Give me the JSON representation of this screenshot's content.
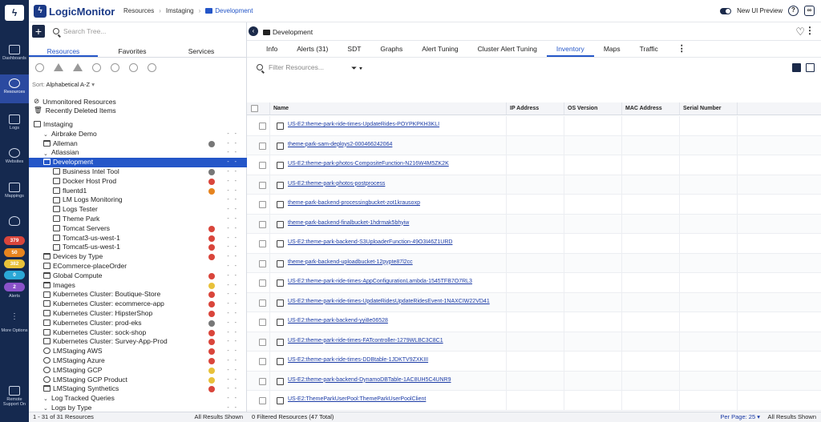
{
  "nav": {
    "items": [
      {
        "label": "Dashboards",
        "icon": "dashboards-icon"
      },
      {
        "label": "Resources",
        "icon": "resources-icon"
      },
      {
        "label": "Logs",
        "icon": "logs-icon"
      },
      {
        "label": "Websites",
        "icon": "websites-icon"
      },
      {
        "label": "Mappings",
        "icon": "mappings-icon"
      }
    ],
    "alert_counts": [
      {
        "value": "379",
        "color": "#d9453b"
      },
      {
        "value": "50",
        "color": "#e6841f"
      },
      {
        "value": "382",
        "color": "#e8c13a"
      },
      {
        "value": "0",
        "color": "#2aa7d6"
      },
      {
        "value": "2",
        "color": "#8a52c9"
      }
    ],
    "alerts_label": "Alerts",
    "more_options_label": "More Options",
    "remote_support_label": "Remote Support On"
  },
  "topbar": {
    "brand": "LogicMonitor",
    "breadcrumbs": [
      "Resources",
      "Imstaging",
      "Development"
    ],
    "new_ui_label": "New UI Preview",
    "help_icon": "help-icon",
    "link_icon": "link-icon"
  },
  "tree": {
    "search_placeholder": "Search Tree...",
    "tabs": [
      "Resources",
      "Favorites",
      "Services"
    ],
    "sort_prefix": "Sort:",
    "sort_value": "Alphabetical A-Z",
    "unmonitored": "Unmonitored Resources",
    "recently_deleted": "Recently Deleted Items",
    "items": [
      {
        "label": "Imstaging",
        "indent": 0,
        "icon": "group",
        "status": ""
      },
      {
        "label": "Airbrake Demo",
        "indent": 1,
        "icon": "caret",
        "status": ""
      },
      {
        "label": "Alleman",
        "indent": 1,
        "icon": "folder",
        "status": "gray"
      },
      {
        "label": "Atlassian",
        "indent": 1,
        "icon": "caret",
        "status": ""
      },
      {
        "label": "Development",
        "indent": 1,
        "icon": "folder",
        "status": "",
        "selected": true
      },
      {
        "label": "Business Intel Tool",
        "indent": 2,
        "icon": "device",
        "status": "gray"
      },
      {
        "label": "Docker Host Prod",
        "indent": 2,
        "icon": "device",
        "status": "red"
      },
      {
        "label": "fluentd1",
        "indent": 2,
        "icon": "device",
        "status": "orange"
      },
      {
        "label": "LM Logs Monitoring",
        "indent": 2,
        "icon": "device",
        "status": ""
      },
      {
        "label": "Logs Tester",
        "indent": 2,
        "icon": "device",
        "status": ""
      },
      {
        "label": "Theme Park",
        "indent": 2,
        "icon": "device",
        "status": ""
      },
      {
        "label": "Tomcat Servers",
        "indent": 2,
        "icon": "device",
        "status": "red"
      },
      {
        "label": "Tomcat3-us-west-1",
        "indent": 2,
        "icon": "device",
        "status": "red"
      },
      {
        "label": "Tomcat5-us-west-1",
        "indent": 2,
        "icon": "device",
        "status": "red"
      },
      {
        "label": "Devices by Type",
        "indent": 1,
        "icon": "folder",
        "status": "red"
      },
      {
        "label": "ECommerce-placeOrder",
        "indent": 1,
        "icon": "device",
        "status": ""
      },
      {
        "label": "Global Compute",
        "indent": 1,
        "icon": "folder",
        "status": "red"
      },
      {
        "label": "Images",
        "indent": 1,
        "icon": "folder",
        "status": "yellow"
      },
      {
        "label": "Kubernetes Cluster: Boutique-Store",
        "indent": 1,
        "icon": "k8s",
        "status": "red"
      },
      {
        "label": "Kubernetes Cluster: ecommerce-app",
        "indent": 1,
        "icon": "k8s",
        "status": "red"
      },
      {
        "label": "Kubernetes Cluster: HipsterShop",
        "indent": 1,
        "icon": "k8s",
        "status": "red"
      },
      {
        "label": "Kubernetes Cluster: prod-eks",
        "indent": 1,
        "icon": "k8s",
        "status": "gray"
      },
      {
        "label": "Kubernetes Cluster: sock-shop",
        "indent": 1,
        "icon": "k8s",
        "status": "red"
      },
      {
        "label": "Kubernetes Cluster: Survey-App-Prod",
        "indent": 1,
        "icon": "k8s",
        "status": "red"
      },
      {
        "label": "LMStaging AWS",
        "indent": 1,
        "icon": "cloud",
        "status": "red"
      },
      {
        "label": "LMStaging Azure",
        "indent": 1,
        "icon": "cloud",
        "status": "red"
      },
      {
        "label": "LMStaging GCP",
        "indent": 1,
        "icon": "cloud",
        "status": "yellow"
      },
      {
        "label": "LMStaging GCP Product",
        "indent": 1,
        "icon": "cloud",
        "status": "yellow"
      },
      {
        "label": "LMStaging Synthetics",
        "indent": 1,
        "icon": "folder",
        "status": "red"
      },
      {
        "label": "Log Tracked Queries",
        "indent": 1,
        "icon": "caret",
        "status": ""
      },
      {
        "label": "Logs by Type",
        "indent": 1,
        "icon": "caret",
        "status": ""
      }
    ],
    "footer_left": "1 - 31 of 31 Resources",
    "footer_right": "All Results Shown"
  },
  "main": {
    "title": "Development",
    "tabs": [
      "Info",
      "Alerts (31)",
      "SDT",
      "Graphs",
      "Alert Tuning",
      "Cluster Alert Tuning",
      "Inventory",
      "Maps",
      "Traffic"
    ],
    "active_tab": "Inventory",
    "filter_placeholder": "Filter Resources...",
    "columns": [
      "Name",
      "IP Address",
      "OS Version",
      "MAC Address",
      "Serial Number"
    ],
    "rows": [
      "US-E2:theme-park-ride-times-UpdateRides-POYPKPKH3KLI",
      "theme-park-sam-deploys2-000466242064",
      "US-E2:theme-park-photos-CompositeFunction-N216W4M5ZK2K",
      "US-E2:theme-park-photos-postprocess",
      "theme-park-backend-processingbucket-zot1krausoxp",
      "theme-park-backend-finalbucket-1hdrmak5bhyiw",
      "US-E2:theme-park-backend-S3UploaderFunction-49O3I46Z1URD",
      "theme-park-backend-uploadbucket-12pypte87l2cc",
      "US-E2:theme-park-ride-times-AppConfigurationLambda-1545TFB7O7RL3",
      "US-E2:theme-park-ride-times-UpdateRidesUpdateRidesEvent-1NAXCIW22VD41",
      "US-E2:theme-park-backend-yyi8e06528",
      "US-E2:theme-park-ride-times-FATcontroller-1279WLBC3C8C1",
      "US-E2:theme-park-ride-times-DDBtable-1JDKTV9ZXKIII",
      "US-E2:theme-park-backend-DynamoDBTable-1AC8UH5C4UNR9",
      "US-E2:ThemeParkUserPool:ThemeParkUserPoolClient"
    ],
    "footer_left": "0 Filtered Resources (47 Total)",
    "per_page": "Per Page: 25",
    "footer_right": "All Results Shown"
  }
}
